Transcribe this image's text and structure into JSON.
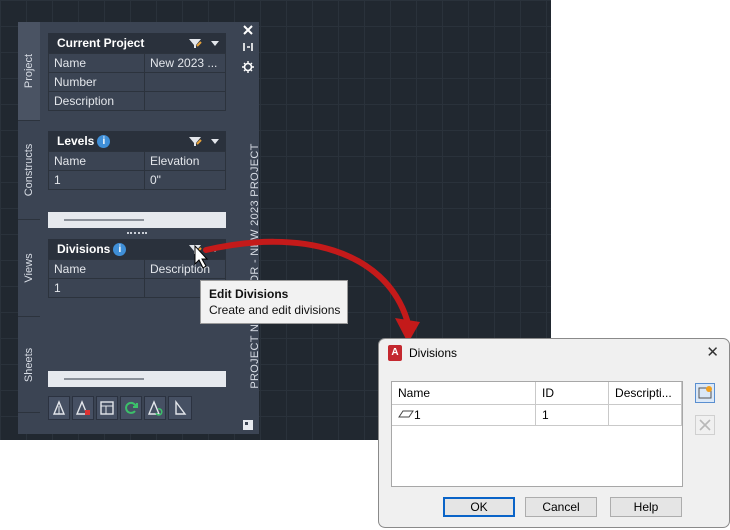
{
  "palette": {
    "vertical_title": "PROJECT NAVIGATOR - NEW 2023 PROJECT",
    "tabs": [
      {
        "label": "Project"
      },
      {
        "label": "Constructs"
      },
      {
        "label": "Views"
      },
      {
        "label": "Sheets"
      }
    ],
    "current_project": {
      "title": "Current Project",
      "rows": [
        {
          "label": "Name",
          "value": "New 2023 ..."
        },
        {
          "label": "Number",
          "value": ""
        },
        {
          "label": "Description",
          "value": ""
        }
      ]
    },
    "levels": {
      "title": "Levels",
      "columns": [
        "Name",
        "Elevation"
      ],
      "rows": [
        [
          "1",
          "0\""
        ]
      ]
    },
    "divisions": {
      "title": "Divisions",
      "columns": [
        "Name",
        "Description"
      ],
      "rows": [
        [
          "1",
          ""
        ]
      ]
    },
    "toolbar_icons": [
      "add-view-icon",
      "delete-view-icon",
      "sheet-set-icon",
      "refresh-icon",
      "regenerate-icon",
      "properties-icon"
    ]
  },
  "tooltip": {
    "title": "Edit Divisions",
    "description": "Create and edit divisions"
  },
  "dialog": {
    "title": "Divisions",
    "app_icon_letter": "A",
    "columns": [
      "Name",
      "ID",
      "Descripti..."
    ],
    "rows": [
      [
        "1",
        "1",
        ""
      ]
    ],
    "buttons": {
      "ok": "OK",
      "cancel": "Cancel",
      "help": "Help"
    }
  },
  "colors": {
    "arrow": "#c41a1a",
    "canvas": "#212830",
    "accent": "#3f8fd8"
  }
}
